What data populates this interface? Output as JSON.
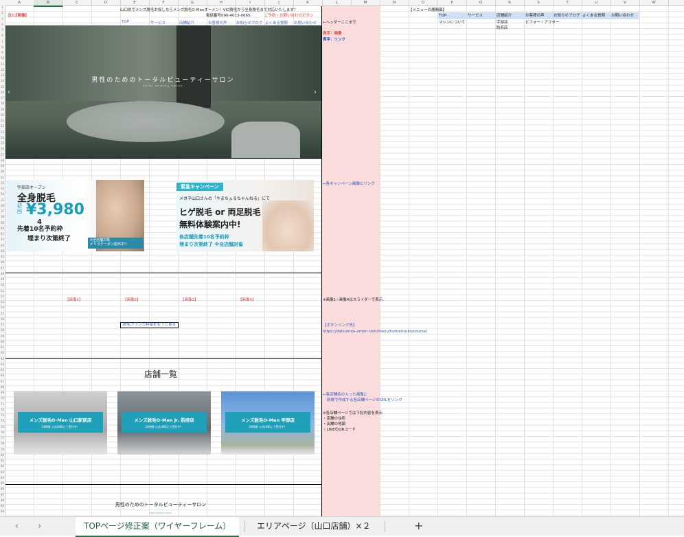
{
  "columns": [
    "A",
    "B",
    "C",
    "D",
    "E",
    "F",
    "G",
    "H",
    "I",
    "J",
    "K",
    "L",
    "M",
    "N",
    "O",
    "P",
    "Q",
    "R",
    "S",
    "T",
    "U",
    "V",
    "W"
  ],
  "selected_column": "B",
  "rows": [
    "1",
    "2",
    "3",
    "4",
    "5",
    "6",
    "7",
    "8",
    "9",
    "10",
    "11",
    "12",
    "13",
    "14",
    "15",
    "16",
    "17",
    "18",
    "19",
    "20",
    "21",
    "22",
    "23",
    "24",
    "25",
    "26",
    "27",
    "28",
    "29",
    "30",
    "31",
    "32",
    "33",
    "34",
    "35",
    "36",
    "37",
    "38",
    "39",
    "40",
    "41",
    "42",
    "43",
    "44",
    "45",
    "46",
    "47",
    "48",
    "49",
    "50",
    "51",
    "52",
    "53",
    "54",
    "55",
    "56",
    "57",
    "58",
    "59",
    "60",
    "61",
    "62",
    "63",
    "64",
    "65",
    "66",
    "67",
    "68",
    "69",
    "70",
    "71",
    "72",
    "73",
    "74",
    "75",
    "76",
    "77",
    "78",
    "79",
    "80",
    "81",
    "82",
    "83",
    "84",
    "85",
    "86",
    "87",
    "88",
    "89",
    "90"
  ],
  "header": {
    "tagline": "山口県でメンズ脱毛お探しならメンズ脱毛O-Menオーメン！VIO脱毛から全身脱毛まで対応いたします！",
    "logo": "【ロゴ画像】",
    "phone": "電話番号090-4013-0665",
    "cta": "ご予約・お問い合わせボタン",
    "nav": [
      "TOP",
      "サービス",
      "店舗紹介",
      "お客様の声",
      "お知らせブログ",
      "よくある質問",
      "お問い合わせ"
    ]
  },
  "notes": {
    "header_note": "←ヘッダーここまで",
    "red_legend": "赤字：画像",
    "blue_legend": "青字：リンク",
    "campaign_note": "←各キャンペーン画像にリンク",
    "slider_note": "※画像1~画像4はスライダーで表示",
    "button_note": "【ボタンリンク先】",
    "button_url": "https://datsumou-omen.com/menu/taimensuko/course/",
    "store_note1": "←各店舗名の入った画像に",
    "store_note2": "新規で作成する各店舗ページのURLをリンク",
    "store_note3": "※各店舗ページでは下記内容を表示",
    "store_item1": "・店舗の住所",
    "store_item2": "・店舗の地図",
    "store_item3": "・LINEのQRコード"
  },
  "menu_map": {
    "title": "【メニューの展開図】",
    "cols": [
      "TOP",
      "サービス",
      "店舗紹介",
      "お客様の声",
      "お知らせブログ",
      "よくある質問",
      "お問い合わせ"
    ],
    "sub_service": "マシンについて",
    "sub_store1": "宇部店",
    "sub_store2": "防府店",
    "sub_voice": "ビフォー・アフター"
  },
  "hero": {
    "title": "男性のためのトータルビューティーサロン",
    "subtitle": "total beauty salon"
  },
  "banner1": {
    "small": "宇部店オープン",
    "big": "全身脱毛",
    "first": "初回",
    "price": "¥3,980",
    "num": "4",
    "seats": "先着10名予約枠",
    "end": "埋まり次第終了",
    "coupon_small": "※全店舗対象",
    "coupon": "ゲリラクーポン配布中!!"
  },
  "banner2": {
    "tag": "緊急キャンペーン",
    "mega": "メガネ山口さんの「やまちょるちゃんねる」にて",
    "main1": "ヒゲ脱毛 or 両足脱毛",
    "main2": "無料体験案内中!",
    "seats": "各店舗先着10名予約枠",
    "end": "埋まり次第終了 ※全店舗対象"
  },
  "slides": [
    "【画像1】",
    "【画像2】",
    "【画像3】",
    "【画像4】"
  ],
  "more_button": "脱毛プランと料金をもっと見る",
  "stores_heading": "店舗一覧",
  "stores": [
    {
      "name": "メンズ脱毛O-Men 山口駅前店",
      "hours": "24時間 公式LINEにて受付中！"
    },
    {
      "name": "メンズ脱毛O-Men Jr. 防府店",
      "hours": "24時間 公式LINEにて受付中！"
    },
    {
      "name": "メンズ脱毛O-Men 宇部店",
      "hours": "24時間 公式LINEにて受付中！"
    }
  ],
  "footer_title": "男性のためのトータルビューティーサロン",
  "footer_sub": "total beauty salon",
  "tabs": {
    "prev": "‹",
    "next": "›",
    "active": "TOPページ修正案（ワイヤーフレーム）",
    "second": "エリアページ（山口店舗）×２",
    "add": "+"
  },
  "colors": {
    "pink_column": "#fadcdc",
    "accent_teal": "#1f9fb8",
    "excel_green": "#217346"
  }
}
